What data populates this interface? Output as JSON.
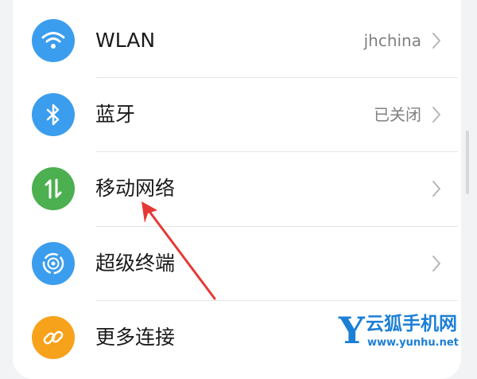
{
  "settings": {
    "items": [
      {
        "title": "WLAN",
        "value": "jhchina",
        "icon": "wifi-icon",
        "icon_color": "#3b9ded"
      },
      {
        "title": "蓝牙",
        "value": "已关闭",
        "icon": "bluetooth-icon",
        "icon_color": "#3b9ded"
      },
      {
        "title": "移动网络",
        "value": "",
        "icon": "mobile-data-icon",
        "icon_color": "#4caf50"
      },
      {
        "title": "超级终端",
        "value": "",
        "icon": "super-device-icon",
        "icon_color": "#3b9ded"
      },
      {
        "title": "更多连接",
        "value": "",
        "icon": "link-icon",
        "icon_color": "#f7a21b"
      }
    ]
  },
  "watermark": {
    "logo_letter": "Y",
    "name": "云狐手机网",
    "url": "www.yunhu.net"
  },
  "colors": {
    "annotation_arrow": "#e53935",
    "watermark": "#1c7fd6"
  }
}
